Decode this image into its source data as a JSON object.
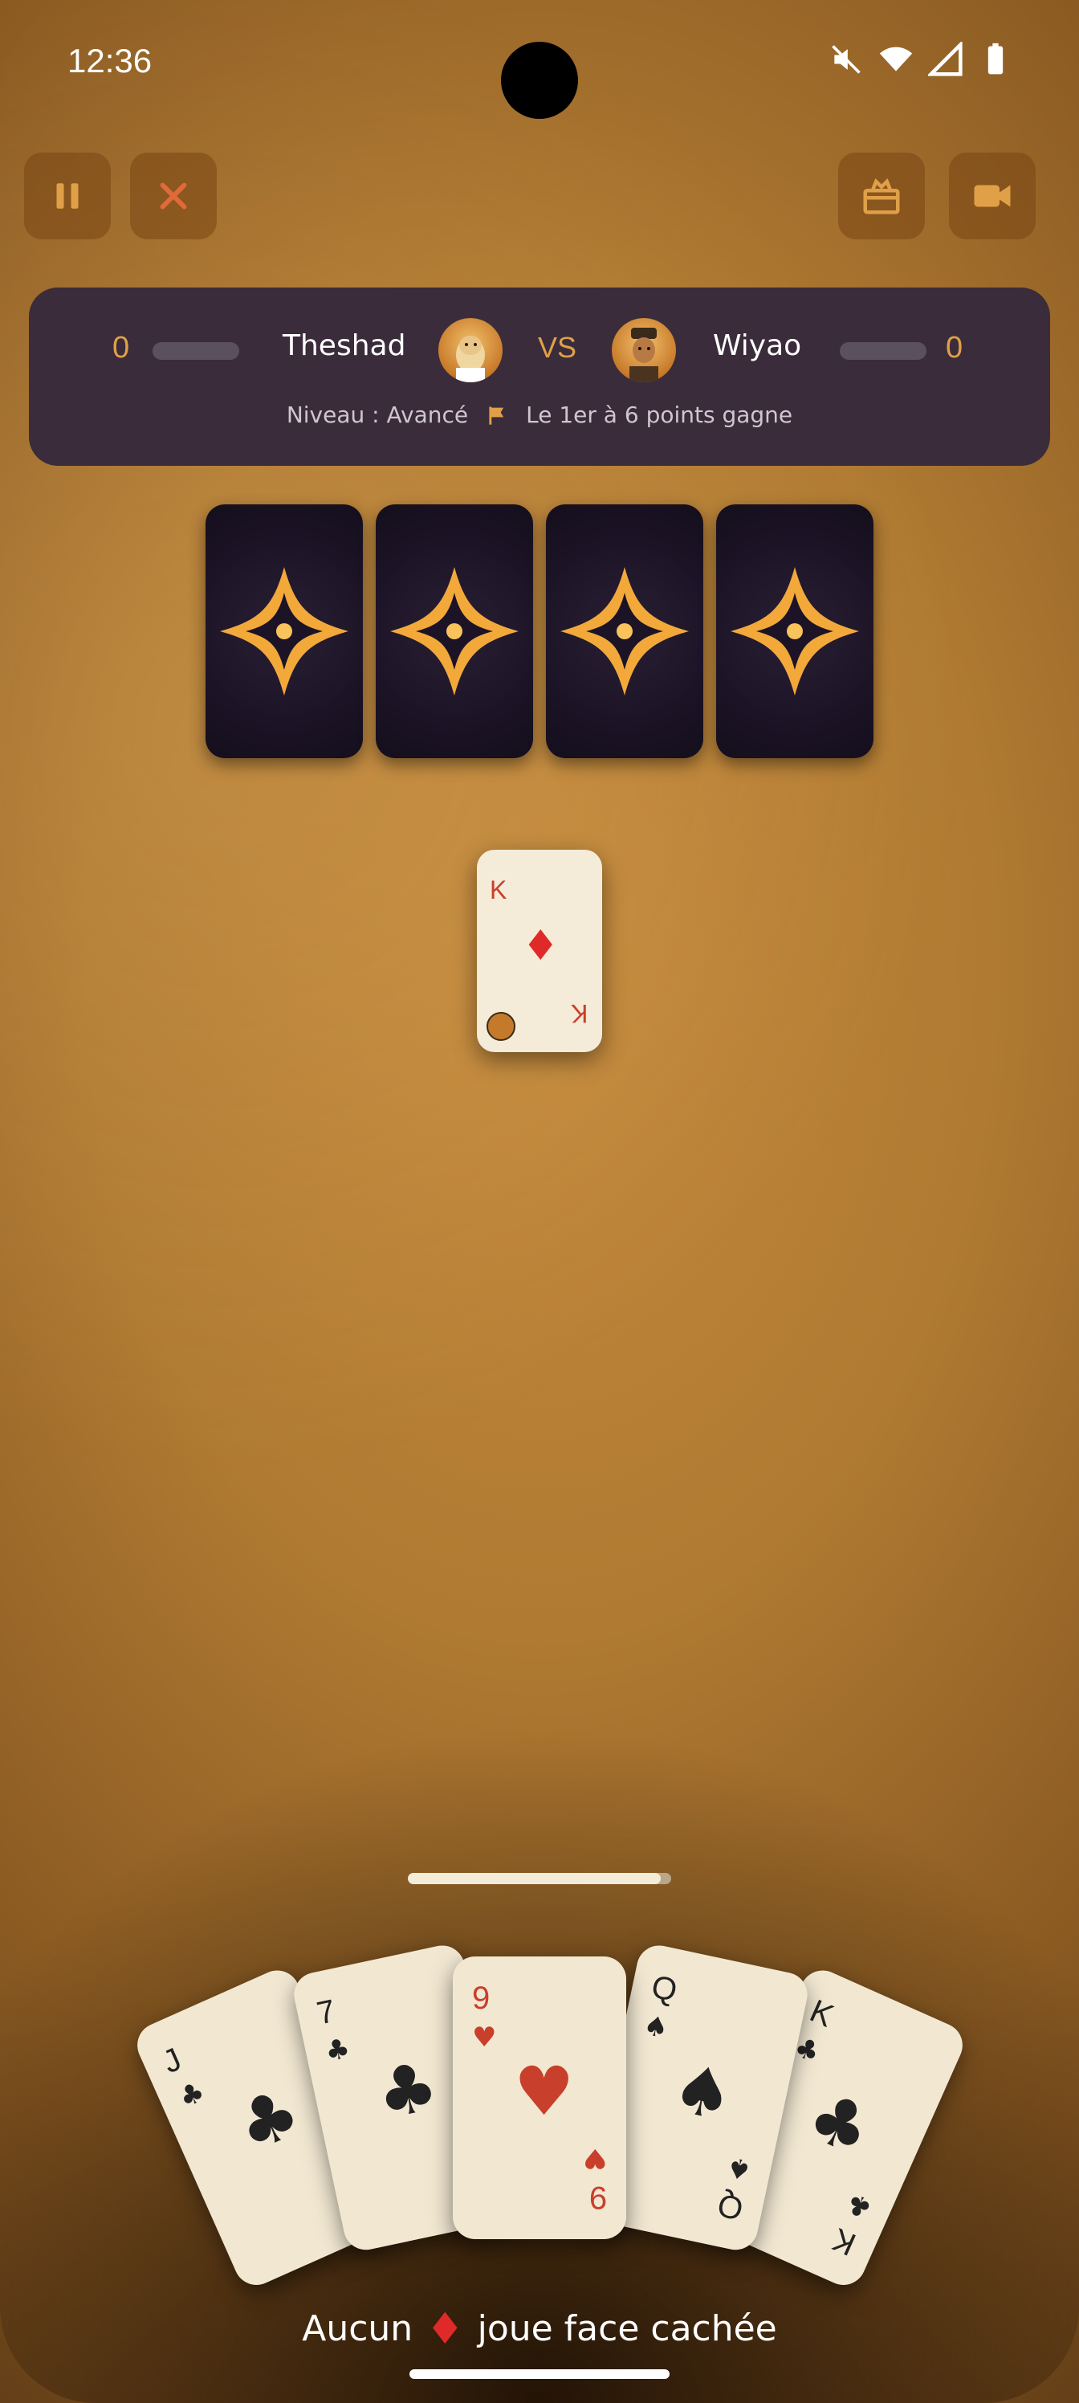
{
  "status": {
    "time": "12:36"
  },
  "top_buttons": {
    "pause": "pause-icon",
    "close": "close-icon",
    "gift": "gift-icon",
    "video": "video-camera-icon"
  },
  "match": {
    "left_player": {
      "name": "Theshad",
      "score": "0",
      "progress": 0
    },
    "vs_label": "VS",
    "right_player": {
      "name": "Wiyao",
      "score": "0",
      "progress": 0
    },
    "level": "Niveau : Avancé",
    "goal": "Le 1er à 6 points gagne"
  },
  "opponent_hand": {
    "face_down_count": 4
  },
  "played_card": {
    "rank": "K",
    "suit": "♦"
  },
  "turn_progress": 0.96,
  "hand": [
    {
      "rank": "J",
      "suit": "♣",
      "color": "#222222"
    },
    {
      "rank": "7",
      "suit": "♣",
      "color": "#222222"
    },
    {
      "rank": "9",
      "suit": "♥",
      "color": "#c8402c"
    },
    {
      "rank": "Q",
      "suit": "♠",
      "color": "#222222"
    },
    {
      "rank": "K",
      "suit": "♣",
      "color": "#222222"
    }
  ],
  "hint": {
    "prefix": "Aucun",
    "suit": "♦",
    "suffix": "joue face cachée"
  },
  "colors": {
    "accent": "#e0a048",
    "panel": "#3a2c3a",
    "red": "#c8402c"
  }
}
